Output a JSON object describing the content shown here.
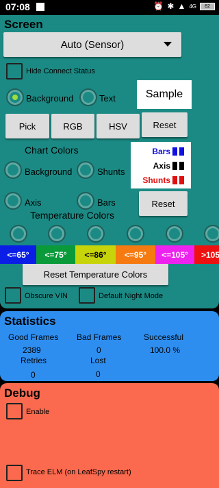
{
  "status_bar": {
    "time": "07:08",
    "icons": [
      "alarm-icon",
      "bluetooth-icon",
      "signal-icon",
      "4g-icon",
      "battery-icon"
    ],
    "battery": "82"
  },
  "screen": {
    "title": "Screen",
    "mode_dropdown": {
      "selected": "Auto (Sensor)"
    },
    "hide_connect_status": {
      "label": "Hide Connect Status",
      "checked": false
    },
    "target_radio": {
      "background_label": "Background",
      "text_label": "Text",
      "selected": "Background"
    },
    "sample_label": "Sample",
    "pick_label": "Pick",
    "rgb_label": "RGB",
    "hsv_label": "HSV",
    "reset_label": "Reset",
    "chart_colors": {
      "title": "Chart Colors",
      "background_label": "Background",
      "shunts_label": "Shunts",
      "axis_label": "Axis",
      "bars_label": "Bars",
      "reset_label": "Reset",
      "legend": [
        {
          "label": "Bars",
          "color": "#1010e0"
        },
        {
          "label": "Axis",
          "color": "#000000"
        },
        {
          "label": "Shunts",
          "color": "#e01010"
        }
      ]
    },
    "temperature_colors": {
      "title": "Temperature Colors",
      "items": [
        {
          "label": "<=65°",
          "color": "#0a1ee6",
          "text_color": "#ffffff"
        },
        {
          "label": "<=75°",
          "color": "#0a9a3a",
          "text_color": "#ffffff"
        },
        {
          "label": "<=86°",
          "color": "#c8d40a",
          "text_color": "#000000"
        },
        {
          "label": "<=95°",
          "color": "#f57a10",
          "text_color": "#ffffff"
        },
        {
          "label": "<=105°",
          "color": "#ee22ee",
          "text_color": "#ffffff"
        },
        {
          "label": ">105",
          "color": "#ee1111",
          "text_color": "#ffffff"
        }
      ],
      "reset_label": "Reset Temperature Colors"
    },
    "obscure_vin": {
      "label": "Obscure VIN",
      "checked": false
    },
    "default_night_mode": {
      "label": "Default Night Mode",
      "checked": false
    }
  },
  "statistics": {
    "title": "Statistics",
    "good_frames_label": "Good Frames",
    "good_frames_value": "2389",
    "bad_frames_label": "Bad Frames",
    "bad_frames_value": "0",
    "successful_label": "Successful",
    "successful_value": "100.0 %",
    "retries_label": "Retries",
    "retries_value": "0",
    "lost_label": "Lost",
    "lost_value": "0"
  },
  "debug": {
    "title": "Debug",
    "enable": {
      "label": "Enable",
      "checked": false
    },
    "trace_elm": {
      "label": "Trace ELM (on LeafSpy restart)",
      "checked": false
    }
  }
}
